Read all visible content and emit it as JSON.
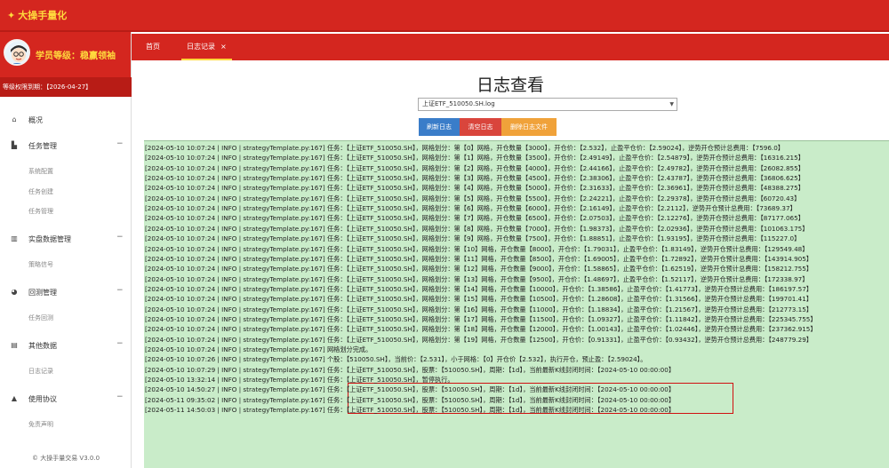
{
  "app": {
    "logo": "大操手量化"
  },
  "profile": {
    "rank": "学员等级：稳赢领袖",
    "expiry": "等级权限到期：【2026-04-27】"
  },
  "menu": {
    "overview": "概况",
    "task_mgmt": "任务管理",
    "sys_config": "系统配置",
    "task_create": "任务创建",
    "task_manage": "任务管理",
    "realtime_data": "实盘数据管理",
    "strategy_signal": "策略信号",
    "backtest": "回测管理",
    "task_backtest": "任务回测",
    "other_data": "其他数据",
    "log_record": "日志记录",
    "agreement": "使用协议",
    "disclaimer": "免责声明",
    "collapse": "−"
  },
  "footer": {
    "version": "© 大操手量交易 V3.0.0"
  },
  "tabs": {
    "home": "首页",
    "log": "日志记录",
    "close": "×"
  },
  "page": {
    "title": "日志查看",
    "select_value": "上证ETF_510050.SH.log",
    "refresh": "刷新日志",
    "clear": "清空日志",
    "delete": "删除日志文件"
  },
  "log_lines": [
    "[2024-05-10 10:07:24 | INFO | strategyTemplate.py:167] 任务：【上证ETF_510050.SH】，网格划分：第【0】网格，开仓数量【3000】，开仓价：【2.532】，止盈平仓价：【2.59024】，逆势开仓预计总费用：【7596.0】",
    "[2024-05-10 10:07:24 | INFO | strategyTemplate.py:167] 任务：【上证ETF_510050.SH】，网格划分：第【1】网格，开仓数量【3500】，开仓价：【2.49149】，止盈平仓价：【2.54879】，逆势开仓预计总费用：【16316.215】",
    "[2024-05-10 10:07:24 | INFO | strategyTemplate.py:167] 任务：【上证ETF_510050.SH】，网格划分：第【2】网格，开仓数量【4000】，开仓价：【2.44166】，止盈平仓价：【2.49782】，逆势开仓预计总费用：【26082.855】",
    "[2024-05-10 10:07:24 | INFO | strategyTemplate.py:167] 任务：【上证ETF_510050.SH】，网格划分：第【3】网格，开仓数量【4500】，开仓价：【2.38306】，止盈平仓价：【2.43787】，逆势开仓预计总费用：【36806.625】",
    "[2024-05-10 10:07:24 | INFO | strategyTemplate.py:167] 任务：【上证ETF_510050.SH】，网格划分：第【4】网格，开仓数量【5000】，开仓价：【2.31633】，止盈平仓价：【2.36961】，逆势开仓预计总费用：【48388.275】",
    "[2024-05-10 10:07:24 | INFO | strategyTemplate.py:167] 任务：【上证ETF_510050.SH】，网格划分：第【5】网格，开仓数量【5500】，开仓价：【2.24221】，止盈平仓价：【2.29378】，逆势开仓预计总费用：【60720.43】",
    "[2024-05-10 10:07:24 | INFO | strategyTemplate.py:167] 任务：【上证ETF_510050.SH】，网格划分：第【6】网格，开仓数量【6000】，开仓价：【2.16149】，止盈平仓价：【2.2112】，逆势开仓预计总费用：【73689.37】",
    "[2024-05-10 10:07:24 | INFO | strategyTemplate.py:167] 任务：【上证ETF_510050.SH】，网格划分：第【7】网格，开仓数量【6500】，开仓价：【2.07503】，止盈平仓价：【2.12276】，逆势开仓预计总费用：【87177.065】",
    "[2024-05-10 10:07:24 | INFO | strategyTemplate.py:167] 任务：【上证ETF_510050.SH】，网格划分：第【8】网格，开仓数量【7000】，开仓价：【1.98373】，止盈平仓价：【2.02936】，逆势开仓预计总费用：【101063.175】",
    "[2024-05-10 10:07:24 | INFO | strategyTemplate.py:167] 任务：【上证ETF_510050.SH】，网格划分：第【9】网格，开仓数量【7500】，开仓价：【1.88851】，止盈平仓价：【1.93195】，逆势开仓预计总费用：【115227.0】",
    "[2024-05-10 10:07:24 | INFO | strategyTemplate.py:167] 任务：【上证ETF_510050.SH】，网格划分：第【10】网格，开仓数量【8000】，开仓价：【1.79031】，止盈平仓价：【1.83149】，逆势开仓预计总费用：【129549.48】",
    "[2024-05-10 10:07:24 | INFO | strategyTemplate.py:167] 任务：【上证ETF_510050.SH】，网格划分：第【11】网格，开仓数量【8500】，开仓价：【1.69005】，止盈平仓价：【1.72892】，逆势开仓预计总费用：【143914.905】",
    "[2024-05-10 10:07:24 | INFO | strategyTemplate.py:167] 任务：【上证ETF_510050.SH】，网格划分：第【12】网格，开仓数量【9000】，开仓价：【1.58865】，止盈平仓价：【1.62519】，逆势开仓预计总费用：【158212.755】",
    "[2024-05-10 10:07:24 | INFO | strategyTemplate.py:167] 任务：【上证ETF_510050.SH】，网格划分：第【13】网格，开仓数量【9500】，开仓价：【1.48697】，止盈平仓价：【1.52117】，逆势开仓预计总费用：【172338.97】",
    "[2024-05-10 10:07:24 | INFO | strategyTemplate.py:167] 任务：【上证ETF_510050.SH】，网格划分：第【14】网格，开仓数量【10000】，开仓价：【1.38586】，止盈平仓价：【1.41773】，逆势开仓预计总费用：【186197.57】",
    "[2024-05-10 10:07:24 | INFO | strategyTemplate.py:167] 任务：【上证ETF_510050.SH】，网格划分：第【15】网格，开仓数量【10500】，开仓价：【1.28608】，止盈平仓价：【1.31566】，逆势开仓预计总费用：【199701.41】",
    "[2024-05-10 10:07:24 | INFO | strategyTemplate.py:167] 任务：【上证ETF_510050.SH】，网格划分：第【16】网格，开仓数量【11000】，开仓价：【1.18834】，止盈平仓价：【1.21567】，逆势开仓预计总费用：【212773.15】",
    "[2024-05-10 10:07:24 | INFO | strategyTemplate.py:167] 任务：【上证ETF_510050.SH】，网格划分：第【17】网格，开仓数量【11500】，开仓价：【1.09327】，止盈平仓价：【1.11842】，逆势开仓预计总费用：【225345.755】",
    "[2024-05-10 10:07:24 | INFO | strategyTemplate.py:167] 任务：【上证ETF_510050.SH】，网格划分：第【18】网格，开仓数量【12000】，开仓价：【1.00143】，止盈平仓价：【1.02446】，逆势开仓预计总费用：【237362.915】",
    "[2024-05-10 10:07:24 | INFO | strategyTemplate.py:167] 任务：【上证ETF_510050.SH】，网格划分：第【19】网格，开仓数量【12500】，开仓价：【0.91331】，止盈平仓价：【0.93432】，逆势开仓预计总费用：【248779.29】",
    "[2024-05-10 10:07:24 | INFO | strategyTemplate.py:167] 网格划分完成。",
    "[2024-05-10 10:07:26 | INFO | strategyTemplate.py:167] 个股：【510050.SH】，当前价：【2.531】，小于网格：【0】开仓价【2.532】，执行开仓，预止盈：【2.59024】。",
    "[2024-05-10 10:07:29 | INFO | strategyTemplate.py:167] 任务：【上证ETF_510050.SH】，股票：【510050.SH】，周期：【1d】，当前最新K线封闭时间：【2024-05-10 00:00:00】",
    "[2024-05-10 13:32:14 | INFO | strategyTemplate.py:167] 任务：【上证ETF_510050.SH】，暂停执行。",
    "[2024-05-10 14:50:27 | INFO | strategyTemplate.py:167] 任务：【上证ETF_510050.SH】，股票：【510050.SH】，周期：【1d】，当前最新K线封闭时间：【2024-05-10 00:00:00】",
    "[2024-05-11 09:35:02 | INFO | strategyTemplate.py:167] 任务：【上证ETF_510050.SH】，股票：【510050.SH】，周期：【1d】，当前最新K线封闭时间：【2024-05-10 00:00:00】",
    "[2024-05-11 14:50:03 | INFO | strategyTemplate.py:167] 任务：【上证ETF_510050.SH】，股票：【510050.SH】，周期：【1d】，当前最新K线封闭时间：【2024-05-10 00:00:00】"
  ]
}
